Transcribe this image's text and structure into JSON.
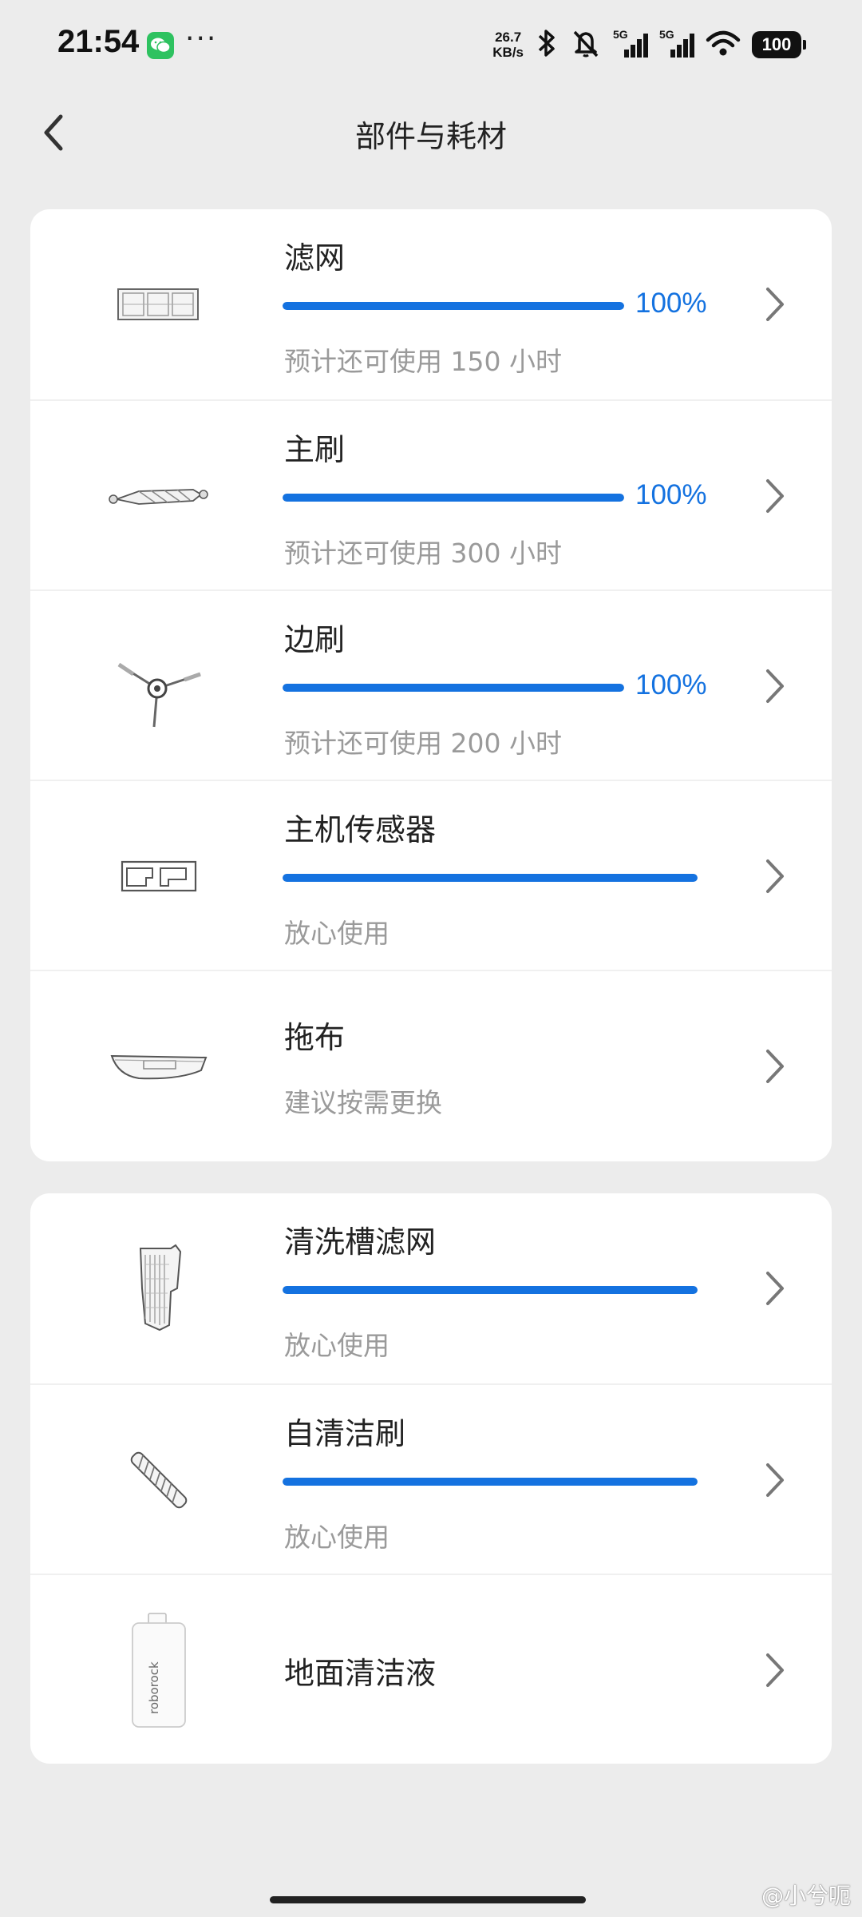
{
  "status_bar": {
    "time": "21:54",
    "more_icon": "···",
    "net_speed_value": "26.7",
    "net_speed_unit": "KB/s",
    "battery": "100",
    "icons": [
      "wechat-icon",
      "bluetooth-icon",
      "mute-icon",
      "signal-5g-icon",
      "wifi-icon",
      "battery-icon"
    ]
  },
  "header": {
    "back_icon": "chevron-left-icon",
    "title": "部件与耗材"
  },
  "colors": {
    "accent": "#1472e0",
    "background": "#ececec",
    "card": "#ffffff",
    "secondary_text": "#9a9a9a"
  },
  "group_1": [
    {
      "name": "滤网",
      "percent": "100%",
      "level": 1.0,
      "detail": "预计还可使用 150 小时",
      "icon": "filter-icon"
    },
    {
      "name": "主刷",
      "percent": "100%",
      "level": 1.0,
      "detail": "预计还可使用 300 小时",
      "icon": "main-brush-icon"
    },
    {
      "name": "边刷",
      "percent": "100%",
      "level": 1.0,
      "detail": "预计还可使用 200 小时",
      "icon": "side-brush-icon"
    },
    {
      "name": "主机传感器",
      "level": 1.0,
      "detail": "放心使用",
      "icon": "sensor-icon"
    },
    {
      "name": "拖布",
      "detail": "建议按需更换",
      "icon": "mop-icon"
    }
  ],
  "group_2": [
    {
      "name": "清洗槽滤网",
      "level": 1.0,
      "detail": "放心使用",
      "icon": "wash-tray-filter-icon"
    },
    {
      "name": "自清洁刷",
      "level": 1.0,
      "detail": "放心使用",
      "icon": "self-cleaning-brush-icon"
    },
    {
      "name": "地面清洁液",
      "icon": "cleaning-solution-icon",
      "bottle_label": "roborock"
    }
  ],
  "watermark": "@小兮呃"
}
